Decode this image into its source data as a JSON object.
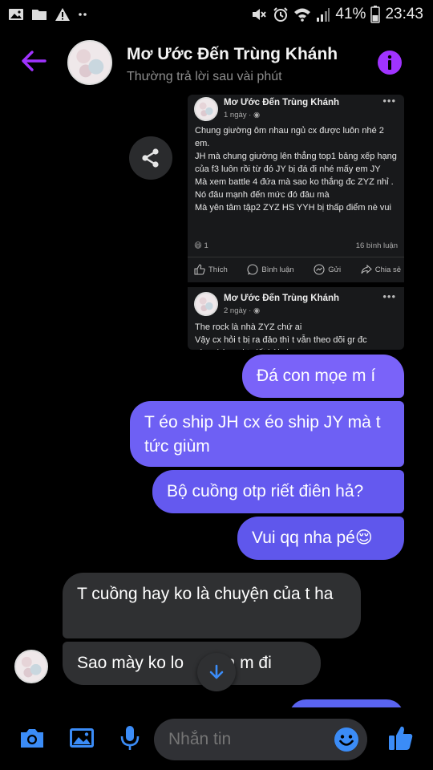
{
  "status_bar": {
    "battery": "41%",
    "time": "23:43"
  },
  "header": {
    "name": "Mơ Ước Đến Trùng Khánh",
    "subtitle": "Thường trả lời sau vài phút"
  },
  "shared_posts": [
    {
      "author": "Mơ Ước Đến Trùng Khánh",
      "time": "1 ngày ·",
      "body": "Chung giường ôm nhau ngủ cx được luôn nhé 2 em.\nJH mà chung giường lên thẳng top1 bảng xếp hạng của f3 luôn rồi từ đó JY bị đá đi nhé mấy em JY\nMà xem battle 4 đứa mà sao ko thắng đc ZYZ nhỉ . Nó đâu mạnh đến mức đó đâu mà\nMà yên tâm tập2 ZYZ HS YYH bị thấp điểm nè vui",
      "reaction_count": "1",
      "comments": "16 bình luận",
      "actions": [
        "Thích",
        "Bình luận",
        "Gửi",
        "Chia sẻ"
      ]
    },
    {
      "author": "Mơ Ước Đến Trùng Khánh",
      "time": "2 ngày ·",
      "body": "The rock là nhà ZYZ chứ ai\nVậy cx hỏi t bị ra đảo thì t vẫn theo dõi gr đc\nvừa chờ mai t viết bài cho xem"
    }
  ],
  "messages": [
    {
      "direction": "out",
      "text": "Đá con mọe m í"
    },
    {
      "direction": "out",
      "text": "T éo ship JH cx éo ship JY mà t tức giùm"
    },
    {
      "direction": "out",
      "text": "Bộ cuồng otp riết điên hả?"
    },
    {
      "direction": "out",
      "text": "Vui qq nha pé😌"
    },
    {
      "direction": "in",
      "text": "T cuồng hay ko là chuyện của t ha"
    },
    {
      "direction": "in",
      "text": "Sao mày ko lo      em m đi"
    }
  ],
  "composer": {
    "placeholder": "Nhắn tin"
  },
  "icons": {
    "status_left": [
      "image-icon",
      "folder-icon",
      "warning-icon",
      "more-dots-icon"
    ],
    "status_right": [
      "mute-icon",
      "alarm-icon",
      "wifi-icon",
      "signal-icon"
    ],
    "composer": [
      "camera-icon",
      "gallery-icon",
      "microphone-icon",
      "emoji-icon",
      "like-icon"
    ]
  },
  "colors": {
    "accent": "#a033ff",
    "outgoing_bubble": "#6e60f4",
    "incoming_bubble": "#2f3032",
    "composer_icon": "#3b8cf7"
  }
}
